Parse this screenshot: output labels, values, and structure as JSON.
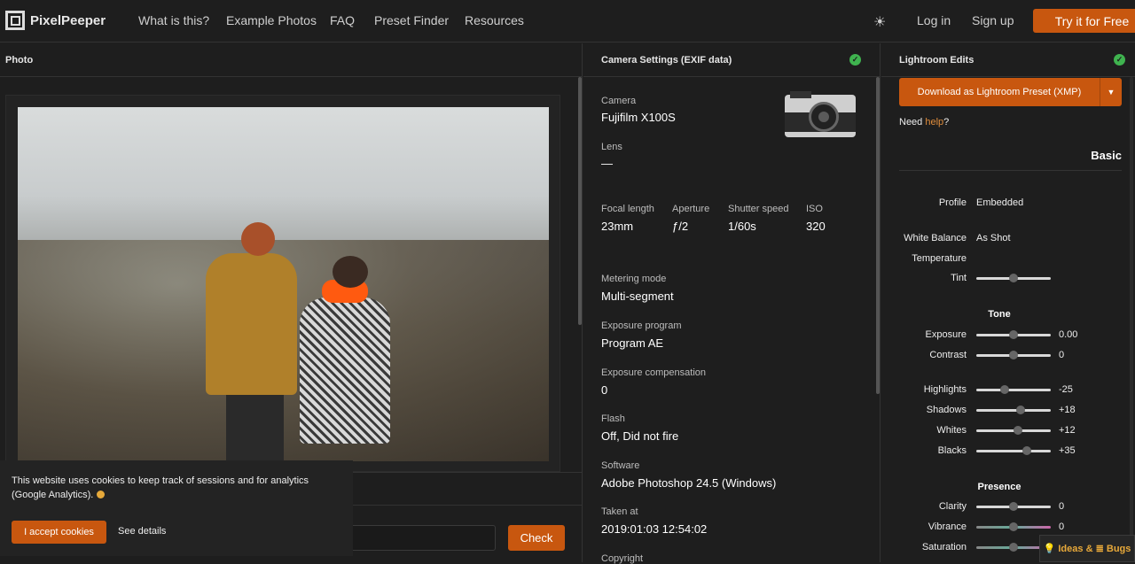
{
  "brand": {
    "name": "PixelPeeper"
  },
  "nav": {
    "items": [
      "What is this?",
      "Example Photos",
      "FAQ",
      "Preset Finder",
      "Resources"
    ],
    "login": "Log in",
    "signup": "Sign up",
    "try": "Try it for Free"
  },
  "photo_panel": {
    "title": "Photo",
    "check_button": "Check"
  },
  "cookie": {
    "text": "This website uses cookies to keep track of sessions and for analytics (Google Analytics).",
    "accept": "I accept cookies",
    "details": "See details"
  },
  "camera_panel": {
    "title": "Camera Settings (EXIF data)",
    "camera": {
      "label": "Camera",
      "value": "Fujifilm X100S"
    },
    "lens": {
      "label": "Lens",
      "value": "—"
    },
    "focal": {
      "label": "Focal length",
      "value": "23mm"
    },
    "aperture": {
      "label": "Aperture",
      "value": "ƒ/2"
    },
    "shutter": {
      "label": "Shutter speed",
      "value": "1/60s"
    },
    "iso": {
      "label": "ISO",
      "value": "320"
    },
    "metering": {
      "label": "Metering mode",
      "value": "Multi-segment"
    },
    "program": {
      "label": "Exposure program",
      "value": "Program AE"
    },
    "comp": {
      "label": "Exposure compensation",
      "value": "0"
    },
    "flash": {
      "label": "Flash",
      "value": "Off, Did not fire"
    },
    "software": {
      "label": "Software",
      "value": "Adobe Photoshop 24.5 (Windows)"
    },
    "taken": {
      "label": "Taken at",
      "value": "2019:01:03 12:54:02"
    },
    "copyright": {
      "label": "Copyright"
    }
  },
  "lr_panel": {
    "title": "Lightroom Edits",
    "download": "Download as Lightroom Preset (XMP)",
    "help_prefix": "Need ",
    "help_link": "help",
    "help_suffix": "?",
    "basic": "Basic",
    "profile": {
      "label": "Profile",
      "value": "Embedded"
    },
    "wb": {
      "label": "White Balance",
      "value": "As Shot"
    },
    "temperature": {
      "label": "Temperature"
    },
    "tint": {
      "label": "Tint",
      "level": 0.5
    },
    "tone": "Tone",
    "exposure": {
      "label": "Exposure",
      "value": "0.00",
      "level": 0.5
    },
    "contrast": {
      "label": "Contrast",
      "value": "0",
      "level": 0.5
    },
    "highlights": {
      "label": "Highlights",
      "value": "-25",
      "level": 0.375
    },
    "shadows": {
      "label": "Shadows",
      "value": "+18",
      "level": 0.59
    },
    "whites": {
      "label": "Whites",
      "value": "+12",
      "level": 0.56
    },
    "blacks": {
      "label": "Blacks",
      "value": "+35",
      "level": 0.675
    },
    "presence": "Presence",
    "clarity": {
      "label": "Clarity",
      "value": "0",
      "level": 0.5
    },
    "vibrance": {
      "label": "Vibrance",
      "value": "0",
      "level": 0.5
    },
    "saturation": {
      "label": "Saturation",
      "level": 0.5
    }
  },
  "feedback": {
    "ideas": "Ideas",
    "amp": "&",
    "bugs": "Bugs"
  },
  "colors": {
    "accent": "#c8570f",
    "ok": "#3fb34f",
    "bg": "#1e1e1e"
  }
}
